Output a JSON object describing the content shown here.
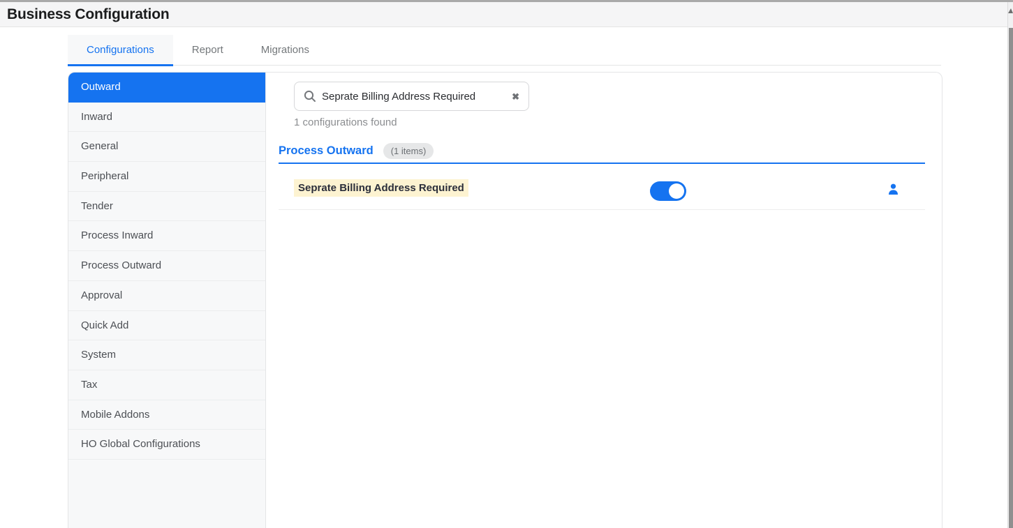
{
  "header": {
    "title": "Business Configuration"
  },
  "tabs": {
    "items": [
      {
        "label": "Configurations",
        "active": true
      },
      {
        "label": "Report",
        "active": false
      },
      {
        "label": "Migrations",
        "active": false
      }
    ]
  },
  "sidebar": {
    "items": [
      {
        "label": "Outward",
        "active": true
      },
      {
        "label": "Inward",
        "active": false
      },
      {
        "label": "General",
        "active": false
      },
      {
        "label": "Peripheral",
        "active": false
      },
      {
        "label": "Tender",
        "active": false
      },
      {
        "label": "Process Inward",
        "active": false
      },
      {
        "label": "Process Outward",
        "active": false
      },
      {
        "label": "Approval",
        "active": false
      },
      {
        "label": "Quick Add",
        "active": false
      },
      {
        "label": "System",
        "active": false
      },
      {
        "label": "Tax",
        "active": false
      },
      {
        "label": "Mobile Addons",
        "active": false
      },
      {
        "label": "HO Global Configurations",
        "active": false
      }
    ]
  },
  "search": {
    "value": "Seprate Billing Address Required",
    "results_text": "1 configurations found",
    "clear_icon": "✖"
  },
  "section": {
    "title": "Process Outward",
    "badge": "(1 items)"
  },
  "rows": [
    {
      "label": "Seprate Billing Address Required",
      "toggle_on": true,
      "highlighted": true
    }
  ],
  "colors": {
    "accent": "#1573f0",
    "highlight": "#fdf3d1",
    "sidebar_bg": "#f7f8f9",
    "header_bg": "#f5f5f6"
  }
}
